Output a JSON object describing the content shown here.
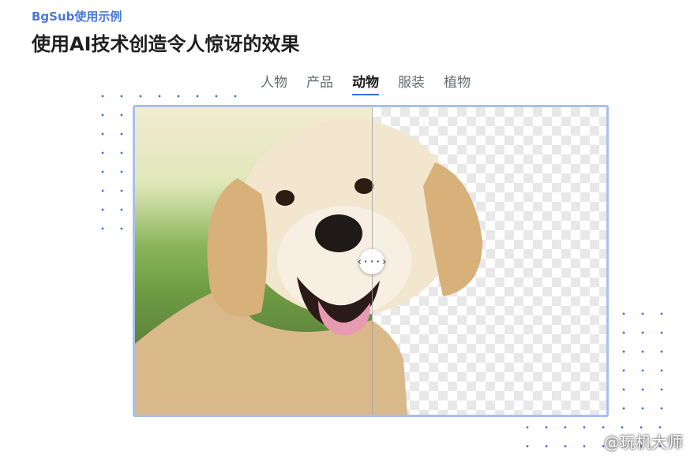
{
  "header": {
    "eyebrow": "BgSub使用示例",
    "title": "使用AI技术创造令人惊讶的效果"
  },
  "tabs": [
    {
      "label": "人物",
      "active": false
    },
    {
      "label": "产品",
      "active": false
    },
    {
      "label": "动物",
      "active": true
    },
    {
      "label": "服装",
      "active": false
    },
    {
      "label": "植物",
      "active": false
    }
  ],
  "comparison": {
    "handle_glyph": "‹···›",
    "split_fraction": 0.5
  },
  "watermark": {
    "text": "@玩机大师",
    "icon": "weibo-logo-icon"
  },
  "colors": {
    "accent": "#4a78d6",
    "frame_border": "#aac0ec",
    "dot_pattern": "#3d6fe0"
  }
}
